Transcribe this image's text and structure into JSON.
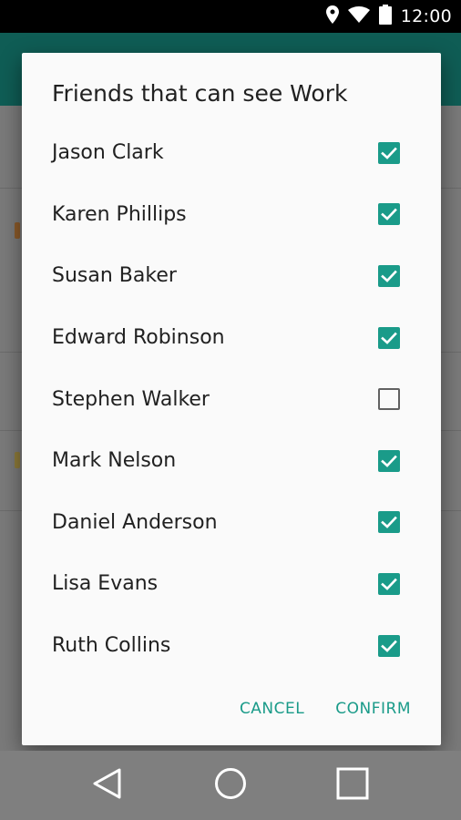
{
  "status_bar": {
    "time": "12:00",
    "icons": [
      "location-pin-icon",
      "wifi-icon",
      "battery-icon"
    ]
  },
  "dialog": {
    "title": "Friends that can see Work",
    "friends": [
      {
        "name": "Jason Clark",
        "checked": true
      },
      {
        "name": "Karen Phillips",
        "checked": true
      },
      {
        "name": "Susan Baker",
        "checked": true
      },
      {
        "name": "Edward Robinson",
        "checked": true
      },
      {
        "name": "Stephen Walker",
        "checked": false
      },
      {
        "name": "Mark Nelson",
        "checked": true
      },
      {
        "name": "Daniel Anderson",
        "checked": true
      },
      {
        "name": "Lisa Evans",
        "checked": true
      },
      {
        "name": "Ruth Collins",
        "checked": true
      }
    ],
    "cancel_label": "CANCEL",
    "confirm_label": "CONFIRM"
  },
  "nav_bar": {
    "icons": [
      "back-icon",
      "home-icon",
      "recents-icon"
    ]
  },
  "colors": {
    "accent": "#1a9b89",
    "toolbar": "#0f5d55",
    "scrim": "#7f7f7f"
  }
}
